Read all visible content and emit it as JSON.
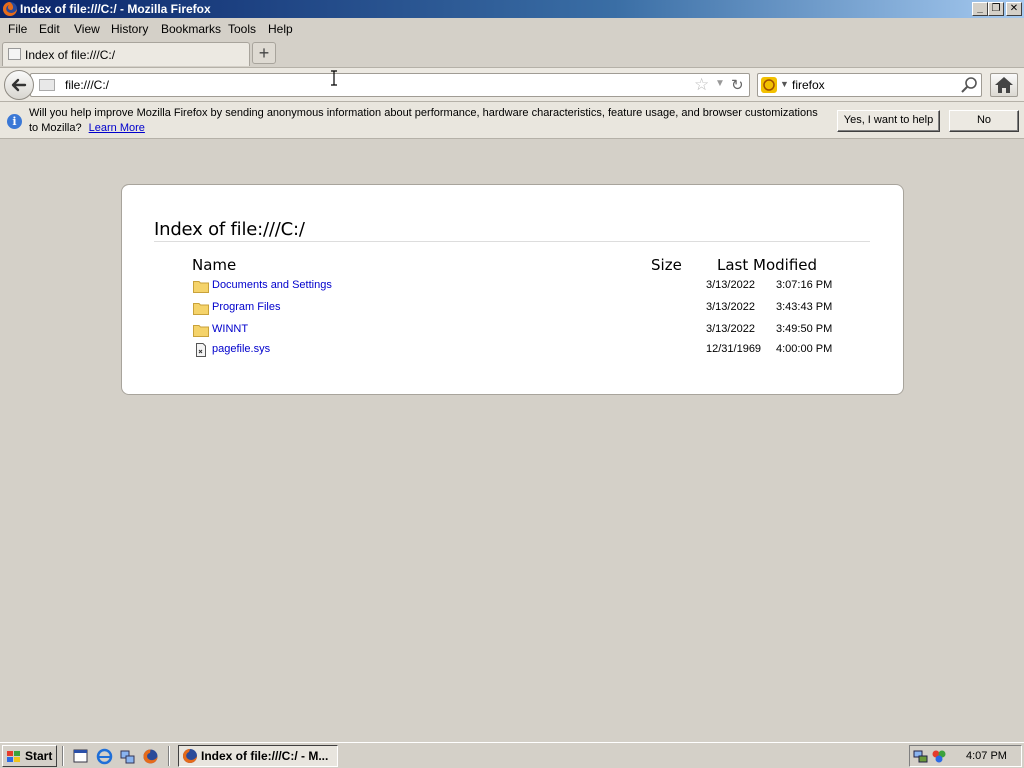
{
  "window": {
    "title": "Index of file:///C:/ - Mozilla Firefox",
    "minimize_glyph": "_",
    "restore_glyph": "❐",
    "close_glyph": "✕"
  },
  "menu": {
    "file": "File",
    "edit": "Edit",
    "view": "View",
    "history": "History",
    "bookmarks": "Bookmarks",
    "tools": "Tools",
    "help": "Help"
  },
  "tabs": [
    {
      "label": "Index of file:///C:/"
    }
  ],
  "newtab_glyph": "+",
  "navbar": {
    "url": "file:///C:/",
    "search_value": "firefox",
    "search_engine_icon": "yahoo-search-icon"
  },
  "notification": {
    "message": "Will you help improve Mozilla Firefox by sending anonymous information about performance, hardware characteristics, feature usage, and browser customizations to Mozilla?",
    "link": "Learn More",
    "yes_button": "Yes, I want to help",
    "no_button": "No",
    "icon": "info-icon"
  },
  "listing": {
    "heading": "Index of file:///C:/",
    "columns": {
      "name": "Name",
      "size": "Size",
      "modified": "Last Modified"
    },
    "rows": [
      {
        "name": "Documents and Settings",
        "type": "folder",
        "size": "",
        "date": "3/13/2022",
        "time": "3:07:16 PM"
      },
      {
        "name": "Program Files",
        "type": "folder",
        "size": "",
        "date": "3/13/2022",
        "time": "3:43:43 PM"
      },
      {
        "name": "WINNT",
        "type": "folder",
        "size": "",
        "date": "3/13/2022",
        "time": "3:49:50 PM"
      },
      {
        "name": "pagefile.sys",
        "type": "file",
        "size": "",
        "date": "12/31/1969",
        "time": "4:00:00 PM"
      }
    ]
  },
  "taskbar": {
    "start": "Start",
    "task": "Index of file:///C:/ - M...",
    "clock": "4:07 PM"
  },
  "colors": {
    "link": "#0000cc",
    "titlebar_start": "#0a246a",
    "titlebar_end": "#a6caf0"
  }
}
